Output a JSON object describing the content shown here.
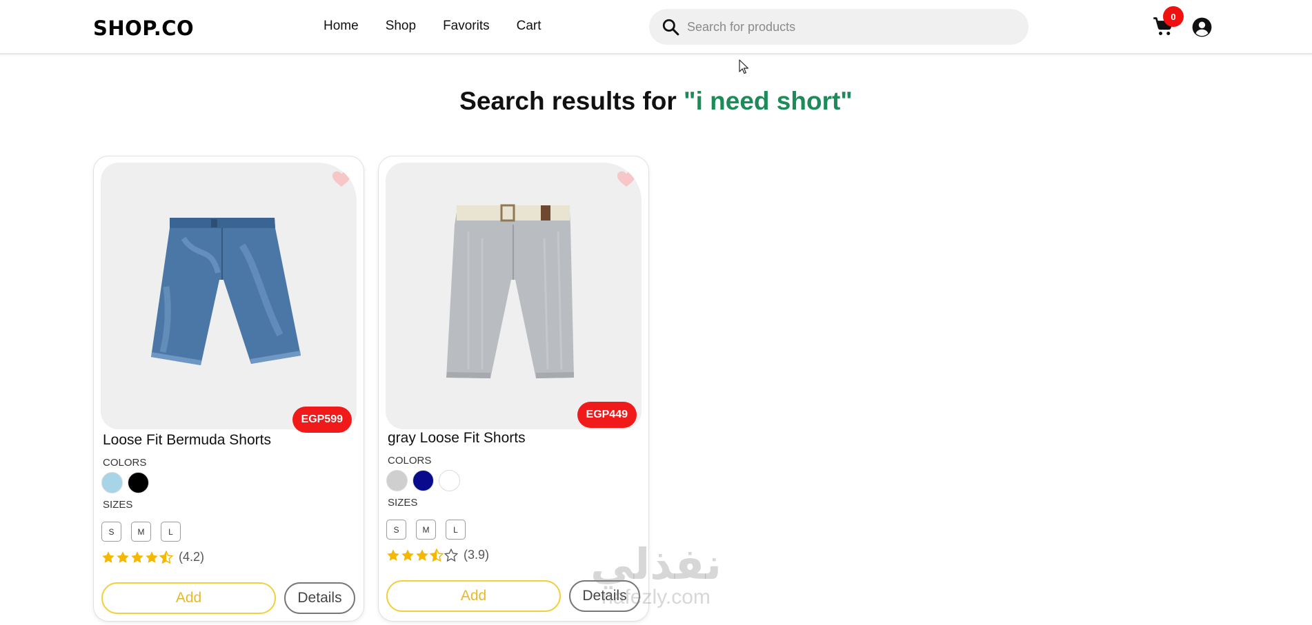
{
  "header": {
    "logo": "SHOP.CO",
    "nav": [
      {
        "label": "Home"
      },
      {
        "label": "Shop"
      },
      {
        "label": "Favorits"
      },
      {
        "label": "Cart"
      }
    ],
    "search": {
      "placeholder": "Search for products",
      "value": "",
      "icon": "search-icon"
    },
    "cart_count": "0",
    "icons": {
      "cart": "cart-icon",
      "account": "account-circle-icon"
    }
  },
  "results": {
    "prefix": "Search results for ",
    "query": "\"i need short\"",
    "accent_color": "#1d8a5a"
  },
  "labels": {
    "colors": "COLORS",
    "sizes": "SIZES",
    "add": "Add",
    "details": "Details"
  },
  "products": [
    {
      "name": "Loose Fit Bermuda Shorts",
      "price": "EGP599",
      "colors": [
        "#a8d4e8",
        "#000000"
      ],
      "sizes": [
        "S",
        "M",
        "L"
      ],
      "rating": 4.2,
      "rating_label": "(4.2)"
    },
    {
      "name": "gray Loose Fit Shorts",
      "price": "EGP449",
      "colors": [
        "#cfcfcf",
        "#0a0a8c",
        "#ffffff"
      ],
      "sizes": [
        "S",
        "M",
        "L"
      ],
      "rating": 3.9,
      "rating_label": "(3.9)"
    }
  ],
  "watermark": {
    "arabic": "نفذلي",
    "latin": "nafezly.com"
  },
  "colors": {
    "price_badge": "#f01a1a",
    "add_border": "#f2cf3c",
    "star": "#f5b800",
    "cart_badge": "#f01010"
  }
}
